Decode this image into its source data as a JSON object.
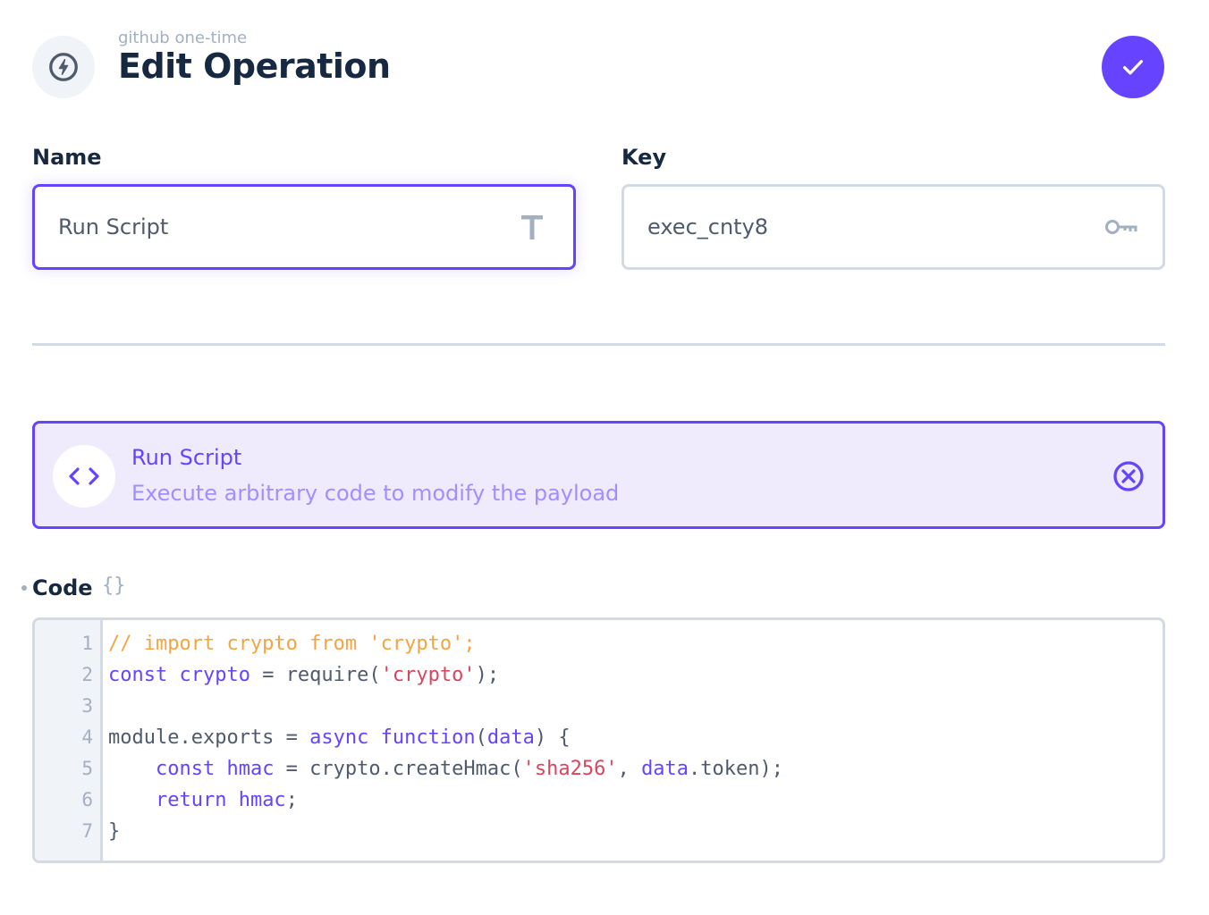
{
  "header": {
    "subtitle": "github one-time",
    "title": "Edit Operation",
    "icon": "bolt-icon",
    "save_icon": "check-icon",
    "accent_color": "#6644ff"
  },
  "fields": {
    "name": {
      "label": "Name",
      "value": "Run Script",
      "icon": "text-T-icon"
    },
    "key": {
      "label": "Key",
      "value": "exec_cnty8",
      "icon": "key-icon"
    }
  },
  "operation": {
    "title": "Run Script",
    "description": "Execute arbitrary code to modify the payload",
    "icon": "code-brackets-icon",
    "close_icon": "close-circle-icon",
    "background_color": "#efebfd"
  },
  "code_editor": {
    "label": "Code",
    "label_icon": "{}",
    "lines": [
      {
        "num": "1",
        "tokens": [
          {
            "t": "// import crypto from 'crypto';",
            "c": "comment"
          }
        ]
      },
      {
        "num": "2",
        "tokens": [
          {
            "t": "const crypto",
            "c": "kw"
          },
          {
            "t": " = require(",
            "c": "plain"
          },
          {
            "t": "'crypto'",
            "c": "str"
          },
          {
            "t": ");",
            "c": "plain"
          }
        ]
      },
      {
        "num": "3",
        "tokens": []
      },
      {
        "num": "4",
        "tokens": [
          {
            "t": "module.exports = ",
            "c": "plain"
          },
          {
            "t": "async function",
            "c": "kw"
          },
          {
            "t": "(",
            "c": "plain"
          },
          {
            "t": "data",
            "c": "kw"
          },
          {
            "t": ") {",
            "c": "plain"
          }
        ]
      },
      {
        "num": "5",
        "tokens": [
          {
            "t": "    ",
            "c": "plain"
          },
          {
            "t": "const hmac",
            "c": "kw"
          },
          {
            "t": " = crypto.createHmac(",
            "c": "plain"
          },
          {
            "t": "'sha256'",
            "c": "str"
          },
          {
            "t": ", ",
            "c": "plain"
          },
          {
            "t": "data",
            "c": "kw"
          },
          {
            "t": ".token);",
            "c": "plain"
          }
        ]
      },
      {
        "num": "6",
        "tokens": [
          {
            "t": "    ",
            "c": "plain"
          },
          {
            "t": "return hmac",
            "c": "kw"
          },
          {
            "t": ";",
            "c": "plain"
          }
        ]
      },
      {
        "num": "7",
        "tokens": [
          {
            "t": "}",
            "c": "plain"
          }
        ]
      }
    ]
  }
}
